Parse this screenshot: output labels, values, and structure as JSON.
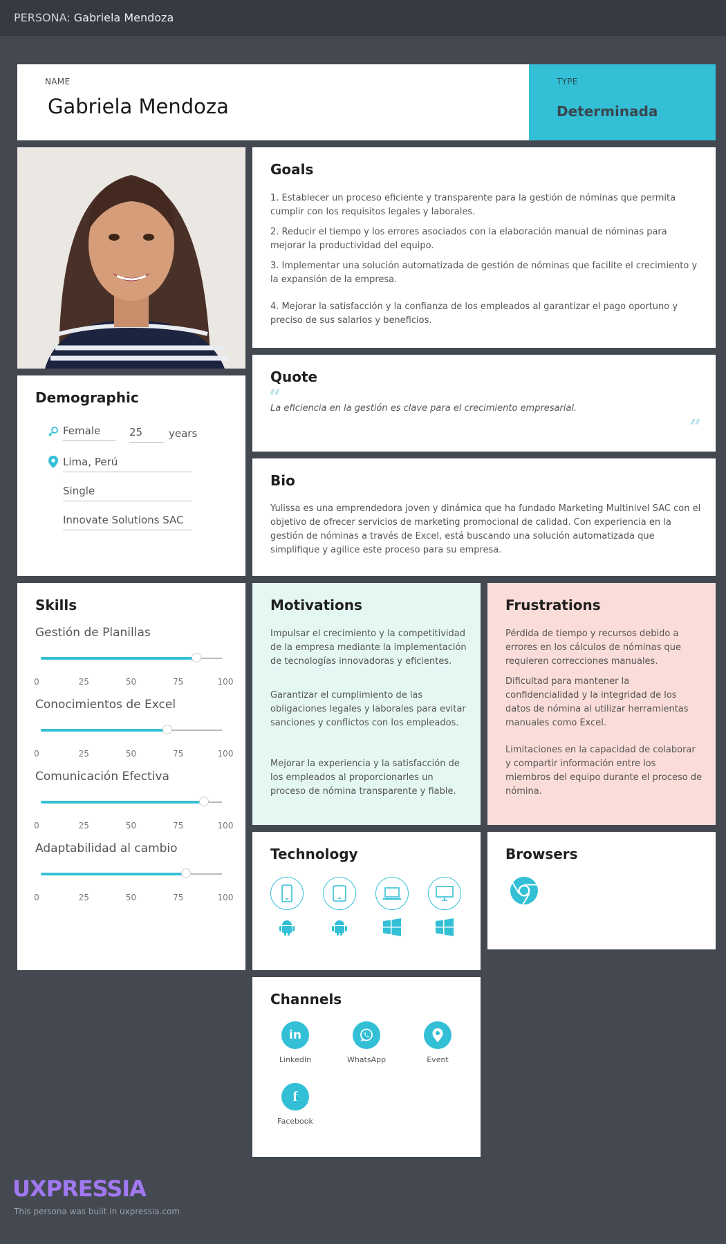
{
  "topbar": {
    "prefix": "PERSONA:",
    "name": "Gabriela Mendoza"
  },
  "header": {
    "name_label": "NAME",
    "name": "Gabriela Mendoza",
    "type_label": "TYPE",
    "type_value": "Determinada"
  },
  "goals": {
    "title": "Goals",
    "items": [
      "1. Establecer un proceso eficiente y transparente para la gestión de nóminas que permita cumplir con los requisitos legales y laborales.",
      "2. Reducir el tiempo y los errores asociados con la elaboración manual de nóminas para mejorar la productividad del equipo.",
      "3. Implementar una solución automatizada de gestión de nóminas que facilite el crecimiento y la expansión de la empresa.",
      "4. Mejorar la satisfacción y la confianza de los empleados al garantizar el pago oportuno y preciso de sus salarios y beneficios."
    ]
  },
  "quote": {
    "title": "Quote",
    "open_mark": "“",
    "close_mark": "”",
    "text": "La eficiencia en la gestión es clave para el crecimiento empresarial."
  },
  "bio": {
    "title": "Bio",
    "text": "Yulissa es una emprendedora joven y dinámica que ha fundado Marketing Multinivel SAC con el objetivo de ofrecer servicios de marketing promocional de calidad. Con experiencia en la gestión de nóminas a través de Excel, está buscando una solución automatizada que simplifique y agilice este proceso para su empresa."
  },
  "demographic": {
    "title": "Demographic",
    "gender": "Female",
    "age": "25",
    "age_unit": "years",
    "location": "Lima, Perú",
    "status": "Single",
    "company": "Innovate Solutions SAC"
  },
  "skills": {
    "title": "Skills",
    "ticks": [
      "0",
      "25",
      "50",
      "75",
      "100"
    ],
    "items": [
      {
        "name": "Gestión de Planillas",
        "value": 86
      },
      {
        "name": "Conocimientos de Excel",
        "value": 70
      },
      {
        "name": "Comunicación Efectiva",
        "value": 90
      },
      {
        "name": "Adaptabilidad al cambio",
        "value": 80
      }
    ]
  },
  "motivations": {
    "title": "Motivations",
    "items": [
      "Impulsar el crecimiento y la competitividad de la empresa mediante la implementación de tecnologías innovadoras y eficientes.",
      "Garantizar el cumplimiento de las obligaciones legales y laborales para evitar sanciones y conflictos con los empleados.",
      "Mejorar la experiencia y la satisfacción de los empleados al proporcionarles un proceso de nómina transparente y fiable."
    ]
  },
  "frustrations": {
    "title": "Frustrations",
    "items": [
      "Pérdida de tiempo y recursos debido a errores en los cálculos de nóminas que requieren correcciones manuales.",
      "Dificultad para mantener la confidencialidad y la integridad de los datos de nómina al utilizar herramientas manuales como Excel.",
      "Limitaciones en la capacidad de colaborar y compartir información entre los miembros del equipo durante el proceso de nómina."
    ]
  },
  "technology": {
    "title": "Technology",
    "devices": [
      "mobile-icon",
      "tablet-icon",
      "laptop-icon",
      "desktop-icon"
    ],
    "os": [
      "android-icon",
      "android-icon",
      "windows-icon",
      "windows-icon"
    ]
  },
  "browsers": {
    "title": "Browsers",
    "items": [
      "chrome-icon"
    ]
  },
  "channels": {
    "title": "Channels",
    "items": [
      {
        "label": "LinkedIn",
        "glyph": "in"
      },
      {
        "label": "WhatsApp",
        "glyph": ""
      },
      {
        "label": "Event",
        "glyph": ""
      },
      {
        "label": "Facebook",
        "glyph": "f"
      }
    ]
  },
  "footer": {
    "brand": "UXPRESSIA",
    "note": "This persona was built in uxpressia.com"
  },
  "colors": {
    "accent": "#33bfd6",
    "background": "#434851",
    "motivations_bg": "#e4f7f3",
    "frustrations_bg": "#fadcd8",
    "brand": "#a178f0"
  }
}
